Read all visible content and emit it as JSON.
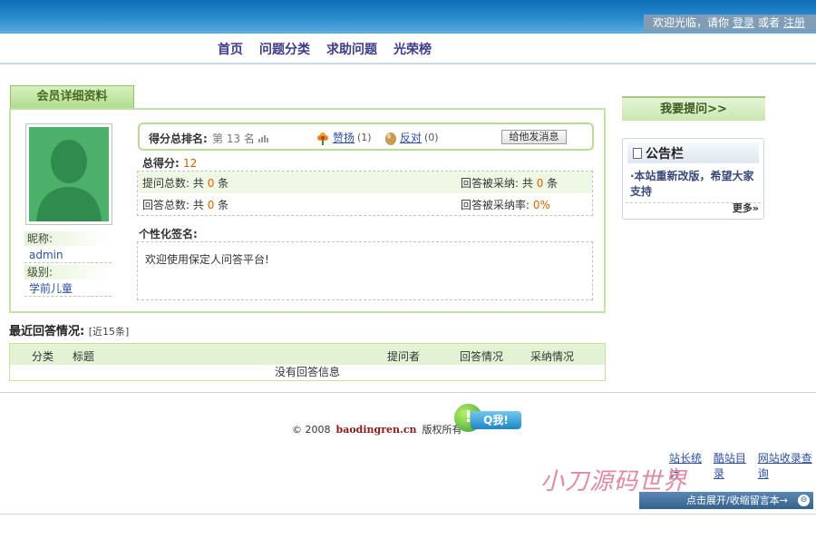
{
  "header": {
    "welcome": "欢迎光临，请你",
    "login": "登录",
    "or": "或者",
    "register": "注册"
  },
  "nav": {
    "items": [
      "首页",
      "问题分类",
      "求助问题",
      "光荣榜"
    ]
  },
  "member": {
    "tab_title": "会员详细资料",
    "nickname_label": "昵称:",
    "nickname": "admin",
    "level_label": "级别:",
    "level": "学前儿童",
    "rank_label": "得分总排名:",
    "rank_text": "第 13 名",
    "praise_label": "赞扬",
    "praise_count": "(1)",
    "oppose_label": "反对",
    "oppose_count": "(0)",
    "message_button": "给他发消息",
    "total_score_label": "总得分:",
    "total_score": "12",
    "questions_label": "提问总数: 共",
    "questions_value": "0",
    "unit": "条",
    "adopted_label": "回答被采纳: 共",
    "adopted_value": "0",
    "answers_label": "回答总数: 共",
    "answers_value": "0",
    "adopt_rate_label": "回答被采纳率:",
    "adopt_rate": "0%",
    "signature_title": "个性化签名:",
    "signature": "欢迎使用保定人问答平台!"
  },
  "sidebar": {
    "ask_button": "我要提问>>",
    "notice_title": "公告栏",
    "notice_item": "·本站重新改版，希望大家支持",
    "more": "更多»"
  },
  "recent": {
    "title": "最近回答情况:",
    "count": "[近15条]",
    "columns": [
      "分类",
      "标题",
      "提问者",
      "回答情况",
      "采纳情况"
    ],
    "empty": "没有回答信息"
  },
  "footer": {
    "copyright_year": "© 2008",
    "domain": "baodingren.cn",
    "rights": "版权所有",
    "qq_label": "Q我!",
    "links": [
      "站长统计",
      "酷站目录",
      "网站收录查询"
    ],
    "watermark": "小刀源码世界",
    "expand": "点击展开/收缩留言本→"
  },
  "colors": {
    "accent_green": "#c2e3a6",
    "header_blue": "#2b8ccd",
    "link_blue": "#2d4ea0",
    "number_orange": "#e06000"
  }
}
